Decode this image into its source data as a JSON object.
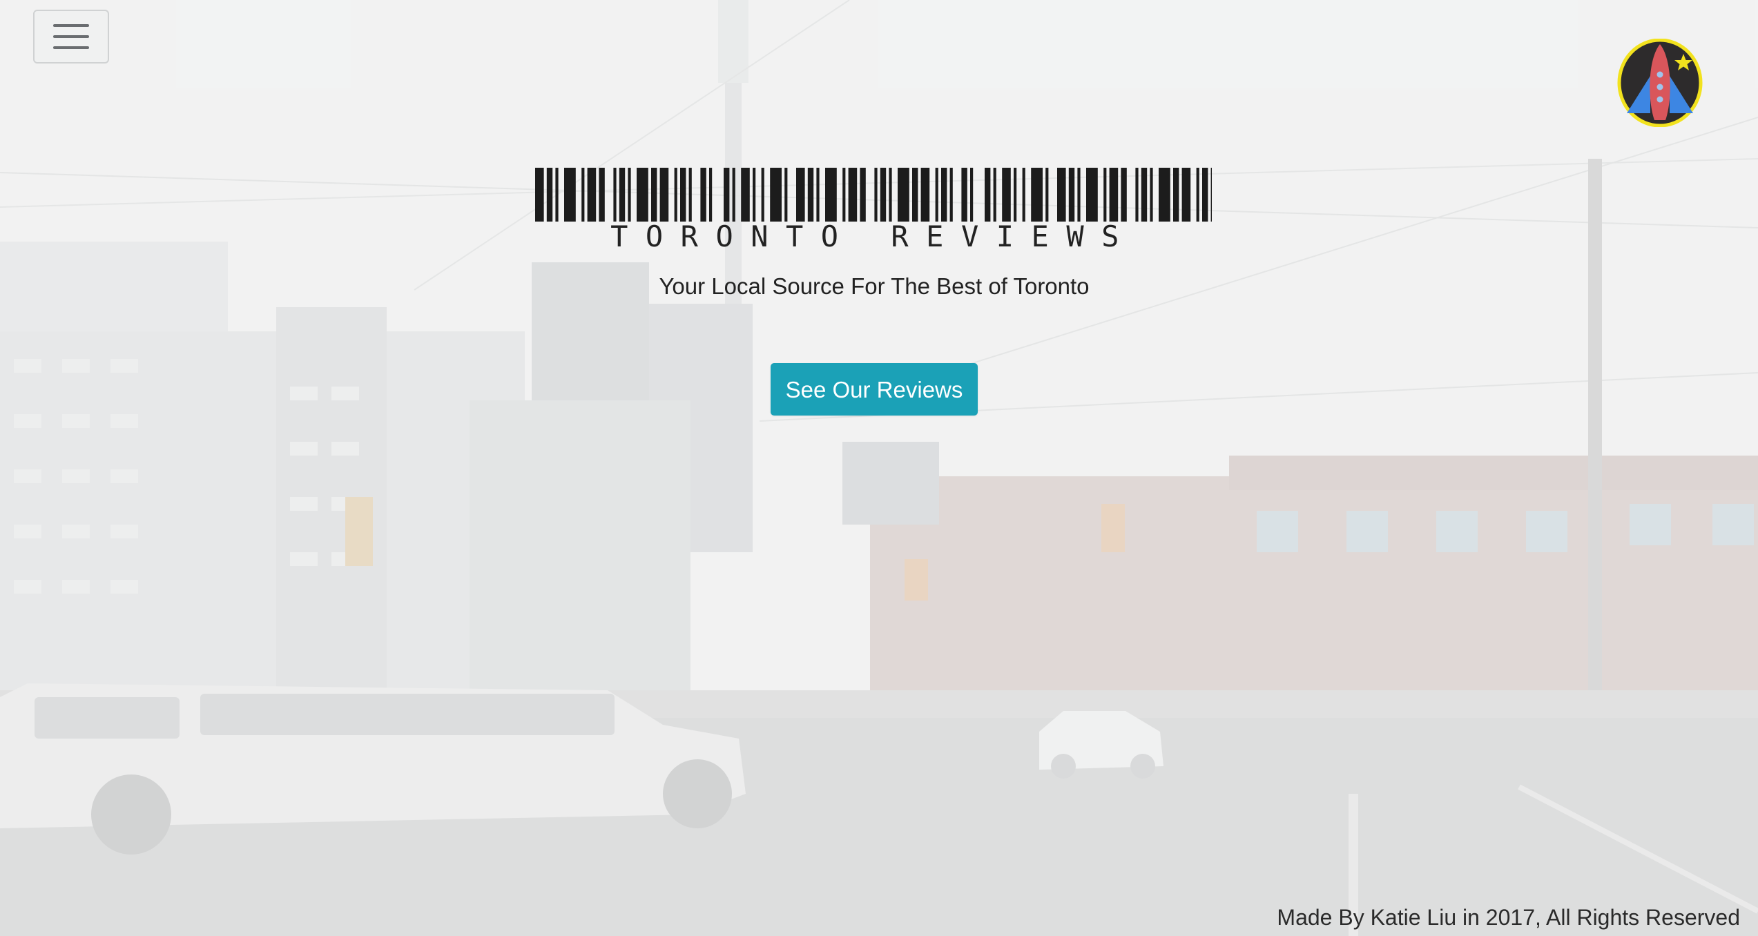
{
  "nav": {
    "menu_icon": "hamburger-icon",
    "logo_icon": "rocket-icon"
  },
  "hero": {
    "title": "TORONTO REVIEWS",
    "subtitle": "Your Local Source For The Best of Toronto",
    "cta_label": "See Our Reviews",
    "barcode_icon": "barcode-icon"
  },
  "footer": {
    "text": "Made By Katie Liu in 2017, All Rights Reserved"
  },
  "colors": {
    "accent": "#1ba1b7",
    "text": "#222222",
    "logo_ring": "#f2e21e",
    "logo_rocket": "#d9565b"
  }
}
